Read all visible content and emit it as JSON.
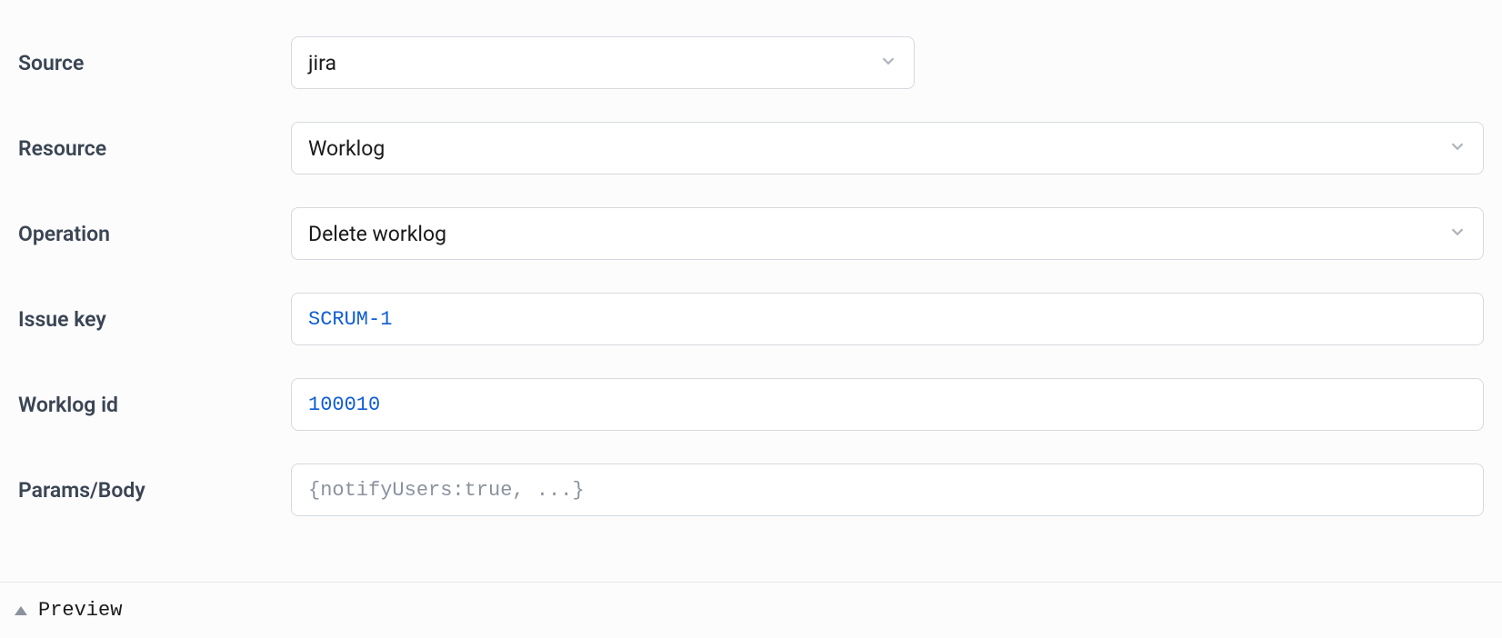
{
  "form": {
    "source": {
      "label": "Source",
      "value": "jira"
    },
    "resource": {
      "label": "Resource",
      "value": "Worklog"
    },
    "operation": {
      "label": "Operation",
      "value": "Delete worklog"
    },
    "issueKey": {
      "label": "Issue key",
      "value": "SCRUM-1"
    },
    "worklogId": {
      "label": "Worklog id",
      "value": "100010"
    },
    "paramsBody": {
      "label": "Params/Body",
      "placeholder": "{notifyUsers:true, ...}",
      "value": ""
    }
  },
  "footer": {
    "preview": "Preview"
  }
}
